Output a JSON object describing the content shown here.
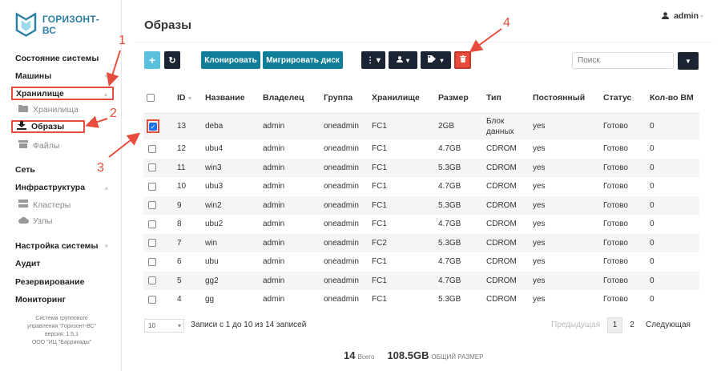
{
  "brand": {
    "name": "ГОРИЗОНТ-ВС"
  },
  "sidebar": {
    "items": [
      {
        "label": "Состояние системы"
      },
      {
        "label": "Машины"
      },
      {
        "label": "Хранилище"
      },
      {
        "label": "Хранилища",
        "icon": "folder-icon"
      },
      {
        "label": "Образы",
        "icon": "download-icon"
      },
      {
        "label": "Файлы",
        "icon": "box-icon"
      },
      {
        "label": "Сеть"
      },
      {
        "label": "Инфраструктура"
      },
      {
        "label": "Кластеры",
        "icon": "server-icon"
      },
      {
        "label": "Узлы",
        "icon": "cloud-icon"
      },
      {
        "label": "Настройка системы"
      },
      {
        "label": "Аудит"
      },
      {
        "label": "Резервирование"
      },
      {
        "label": "Мониторинг"
      }
    ],
    "footer": [
      "Система группового",
      "управления \"Горизонт-ВС\"",
      "версия: 1.5.1",
      "ООО \"ИЦ \"Баррикады\""
    ]
  },
  "header": {
    "title": "Образы",
    "user": "admin"
  },
  "toolbar": {
    "clone_label": "Клонировать",
    "migrate_label": "Мигрировать диск",
    "search_placeholder": "Поиск"
  },
  "table": {
    "columns": [
      "ID",
      "Название",
      "Владелец",
      "Группа",
      "Хранилище",
      "Размер",
      "Тип",
      "Постоянный",
      "Статус",
      "Кол-во ВМ"
    ],
    "rows": [
      {
        "id": "13",
        "name": "deba",
        "owner": "admin",
        "group": "oneadmin",
        "ds": "FC1",
        "size": "2GB",
        "type": "Блок данных",
        "persistent": "yes",
        "status": "Готово",
        "vms": "0",
        "checked": true
      },
      {
        "id": "12",
        "name": "ubu4",
        "owner": "admin",
        "group": "oneadmin",
        "ds": "FC1",
        "size": "4.7GB",
        "type": "CDROM",
        "persistent": "yes",
        "status": "Готово",
        "vms": "0"
      },
      {
        "id": "11",
        "name": "win3",
        "owner": "admin",
        "group": "oneadmin",
        "ds": "FC1",
        "size": "5.3GB",
        "type": "CDROM",
        "persistent": "yes",
        "status": "Готово",
        "vms": "0"
      },
      {
        "id": "10",
        "name": "ubu3",
        "owner": "admin",
        "group": "oneadmin",
        "ds": "FC1",
        "size": "4.7GB",
        "type": "CDROM",
        "persistent": "yes",
        "status": "Готово",
        "vms": "0"
      },
      {
        "id": "9",
        "name": "win2",
        "owner": "admin",
        "group": "oneadmin",
        "ds": "FC1",
        "size": "5.3GB",
        "type": "CDROM",
        "persistent": "yes",
        "status": "Готово",
        "vms": "0"
      },
      {
        "id": "8",
        "name": "ubu2",
        "owner": "admin",
        "group": "oneadmin",
        "ds": "FC1",
        "size": "4.7GB",
        "type": "CDROM",
        "persistent": "yes",
        "status": "Готово",
        "vms": "0"
      },
      {
        "id": "7",
        "name": "win",
        "owner": "admin",
        "group": "oneadmin",
        "ds": "FC2",
        "size": "5.3GB",
        "type": "CDROM",
        "persistent": "yes",
        "status": "Готово",
        "vms": "0"
      },
      {
        "id": "6",
        "name": "ubu",
        "owner": "admin",
        "group": "oneadmin",
        "ds": "FC1",
        "size": "4.7GB",
        "type": "CDROM",
        "persistent": "yes",
        "status": "Готово",
        "vms": "0"
      },
      {
        "id": "5",
        "name": "gg2",
        "owner": "admin",
        "group": "oneadmin",
        "ds": "FC1",
        "size": "4.7GB",
        "type": "CDROM",
        "persistent": "yes",
        "status": "Готово",
        "vms": "0"
      },
      {
        "id": "4",
        "name": "gg",
        "owner": "admin",
        "group": "oneadmin",
        "ds": "FC1",
        "size": "5.3GB",
        "type": "CDROM",
        "persistent": "yes",
        "status": "Готово",
        "vms": "0"
      }
    ]
  },
  "pagination": {
    "page_size": "10",
    "info": "Записи с 1 до 10 из 14 записей",
    "prev": "Предыдущая",
    "pages": [
      "1",
      "2"
    ],
    "next": "Следующая"
  },
  "summary": {
    "count": "14",
    "count_label": "Всего",
    "size": "108.5GB",
    "size_label": "ОБЩИЙ РАЗМЕР"
  },
  "annotations": [
    "1",
    "2",
    "3",
    "4"
  ],
  "colors": {
    "accent": "#0e7e9a",
    "highlight": "#e74c3c",
    "dark": "#1b2433"
  }
}
